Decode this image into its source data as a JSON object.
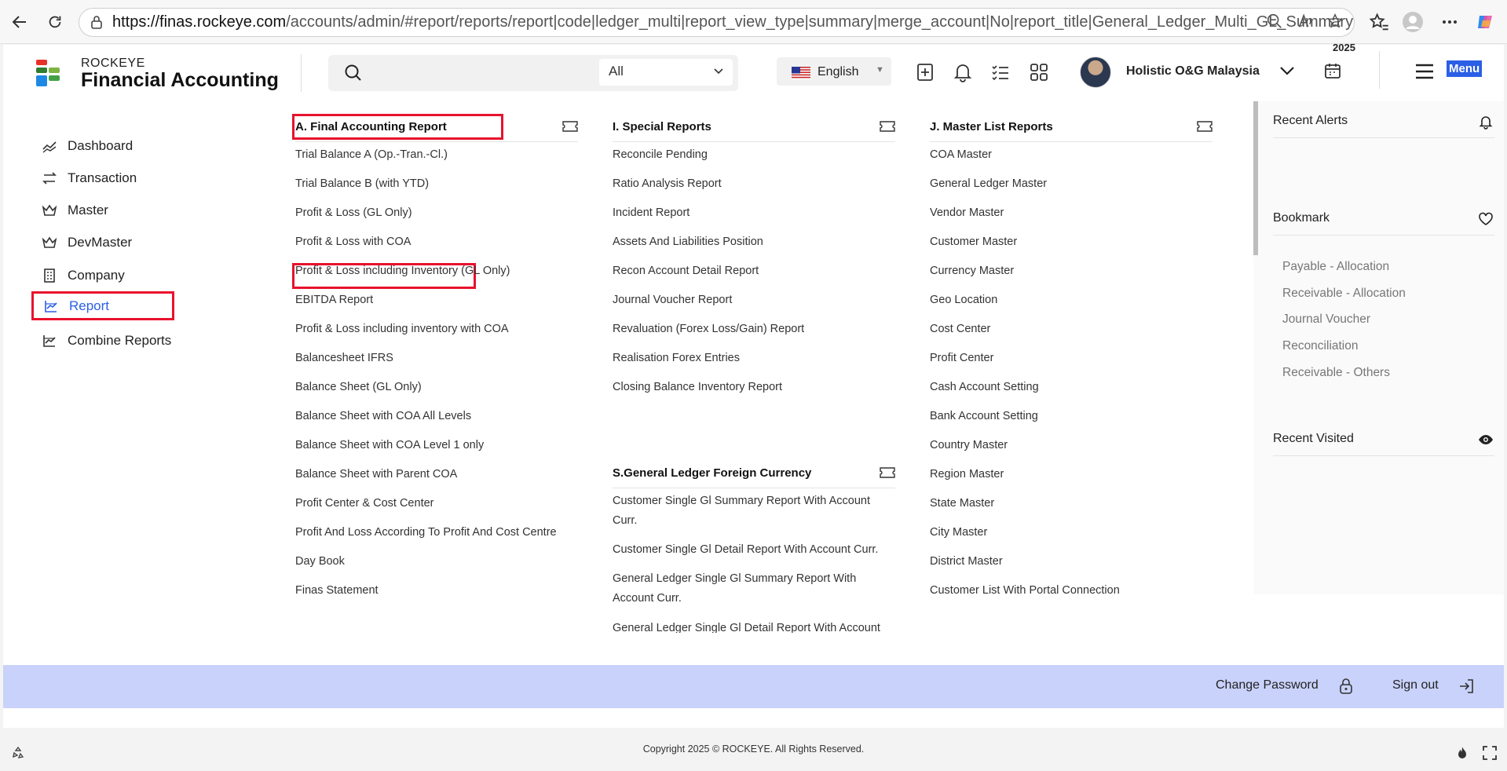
{
  "browser": {
    "url_host": "https://finas.rockeye.com",
    "url_path": "/accounts/admin/#report/reports/report|code|ledger_multi|report_view_type|summary|merge_account|No|report_title|General_Ledger_Multi_GL_Summary_Report"
  },
  "header": {
    "brand_top": "ROCKEYE",
    "brand_main": "Financial Accounting",
    "search_placeholder": "",
    "search_scope": "All",
    "language": "English",
    "company": "Holistic O&G Malaysia",
    "year": "2025",
    "menu_label": "Menu"
  },
  "sidebar": {
    "items": [
      {
        "label": "Dashboard",
        "icon": "chart-line-icon"
      },
      {
        "label": "Transaction",
        "icon": "swap-arrows-icon"
      },
      {
        "label": "Master",
        "icon": "crown-icon"
      },
      {
        "label": "DevMaster",
        "icon": "crown-icon"
      },
      {
        "label": "Company",
        "icon": "building-icon"
      },
      {
        "label": "Report",
        "icon": "report-chart-icon",
        "active": true
      },
      {
        "label": "Combine Reports",
        "icon": "report-chart-icon"
      }
    ]
  },
  "reports": {
    "final_accounting": {
      "title": "A. Final Accounting Report",
      "items": [
        "Trial Balance A (Op.-Tran.-Cl.)",
        "Trial Balance B (with YTD)",
        "Profit & Loss (GL Only)",
        "Profit & Loss with COA",
        "Profit & Loss including Inventory (GL Only)",
        "EBITDA Report",
        "Profit & Loss including inventory with COA",
        "Balancesheet IFRS",
        "Balance Sheet (GL Only)",
        "Balance Sheet with COA All Levels",
        "Balance Sheet with COA Level 1 only",
        "Balance Sheet with Parent COA",
        "Profit Center & Cost Center",
        "Profit And Loss According To Profit And Cost Centre",
        "Day Book",
        "Finas Statement"
      ]
    },
    "special": {
      "title": "I. Special Reports",
      "items": [
        "Reconcile Pending",
        "Ratio Analysis Report",
        "Incident Report",
        "Assets And Liabilities Position",
        "Recon Account Detail Report",
        "Journal Voucher Report",
        "Revaluation (Forex Loss/Gain) Report",
        "Realisation Forex Entries",
        "Closing Balance Inventory Report"
      ]
    },
    "gl_foreign": {
      "title": "S.General Ledger Foreign Currency",
      "items": [
        "Customer Single Gl Summary Report With Account Curr.",
        "Customer Single Gl Detail Report With Account Curr.",
        "General Ledger Single Gl Summary Report With Account Curr.",
        "General Ledger Single Gl Detail Report With Account"
      ]
    },
    "master_list": {
      "title": "J. Master List Reports",
      "items": [
        "COA Master",
        "General Ledger Master",
        "Vendor Master",
        "Customer Master",
        "Currency Master",
        "Geo Location",
        "Cost Center",
        "Profit Center",
        "Cash Account Setting",
        "Bank Account Setting",
        "Country Master",
        "Region Master",
        "State Master",
        "City Master",
        "District Master",
        "Customer List With Portal Connection"
      ]
    }
  },
  "right_panel": {
    "alerts_title": "Recent Alerts",
    "bookmark_title": "Bookmark",
    "bookmarks": [
      "Payable - Allocation",
      "Receivable - Allocation",
      "Journal Voucher",
      "Reconciliation",
      "Receivable - Others"
    ],
    "visited_title": "Recent Visited"
  },
  "footer": {
    "change_password": "Change Password",
    "sign_out": "Sign out",
    "copyright": "Copyright 2025 © ROCKEYE. All Rights Reserved."
  },
  "colors": {
    "accent": "#2b5fe6",
    "highlight": "#e8122d",
    "footer_bar": "#c9d2fb"
  }
}
